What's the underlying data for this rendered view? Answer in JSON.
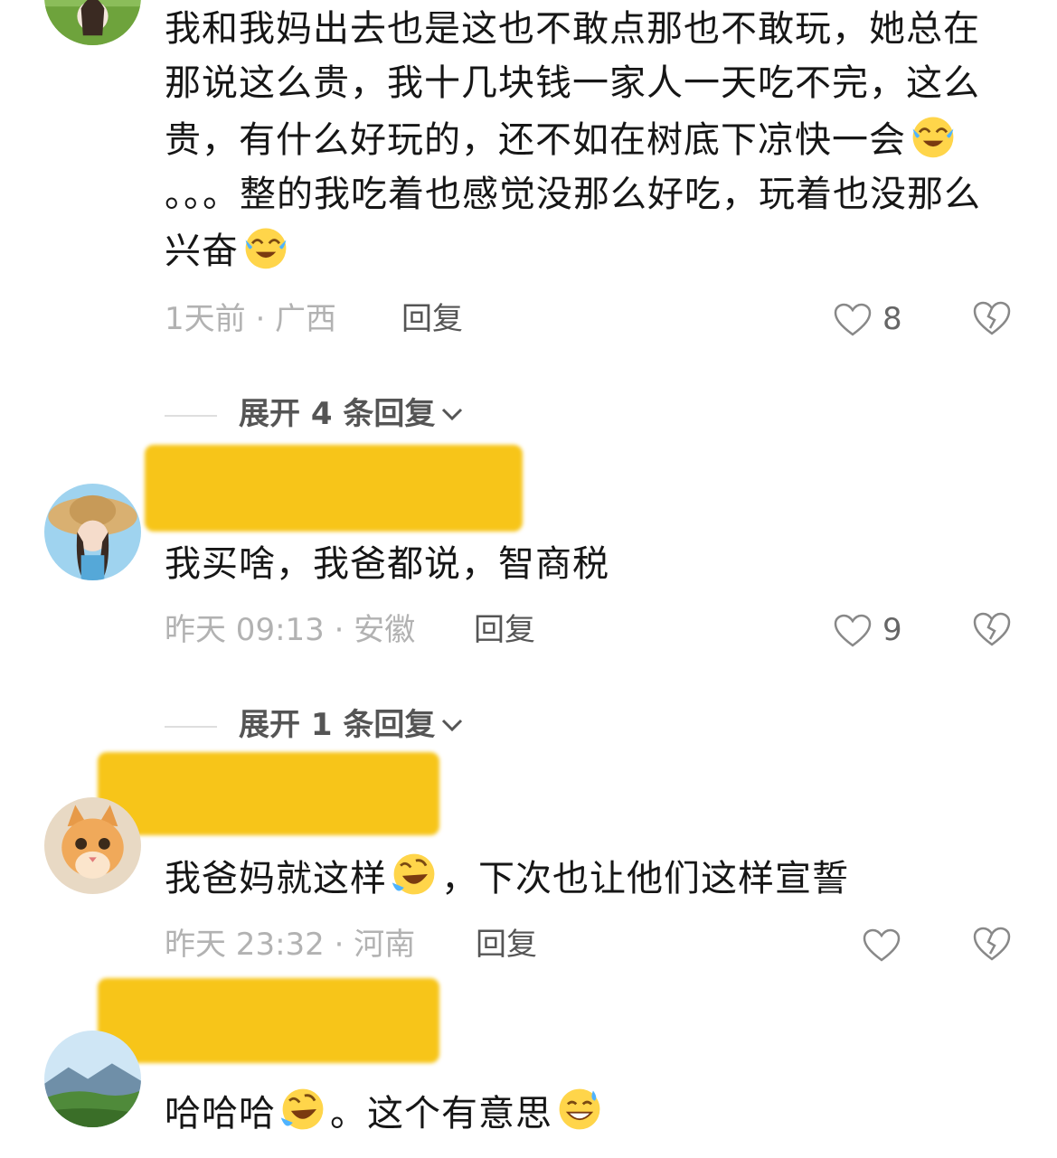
{
  "comments": [
    {
      "avatar": "avatar-girl-field",
      "text_parts": [
        "我和我妈出去也是这也不敢点那也不敢玩，她总在那说这么贵，我十几块钱一家人一天吃不完，这么贵，有什么好玩的，还不如在树底下凉快一会",
        {
          "emoji": "tears-of-joy-emoji"
        },
        "。。。整的我吃着也感觉没那么好吃，玩着也没那么兴奋",
        {
          "emoji": "tears-of-joy-emoji"
        }
      ],
      "time_location": "1天前 · 广西",
      "reply_label": "回复",
      "likes": "8"
    },
    {
      "avatar": "avatar-girl-straw-hat",
      "text_parts": [
        "我买啥，我爸都说，智商税"
      ],
      "time_location": "昨天 09:13 · 安徽",
      "reply_label": "回复",
      "likes": "9"
    },
    {
      "avatar": "avatar-orange-kitten",
      "text_parts": [
        "我爸妈就这样",
        {
          "emoji": "rolling-laughing-emoji"
        },
        "，下次也让他们这样宣誓"
      ],
      "time_location": "昨天 23:32 · 河南",
      "reply_label": "回复",
      "likes": ""
    },
    {
      "avatar": "avatar-mountain-landscape",
      "text_parts": [
        "哈哈哈",
        {
          "emoji": "rolling-laughing-emoji"
        },
        "。这个有意思",
        {
          "emoji": "grinning-sweat-emoji"
        }
      ]
    }
  ],
  "expand_1": "展开 4 条回复",
  "expand_2": "展开 1 条回复",
  "colors": {
    "redaction": "#f7c519",
    "meta_text": "#b2b2b2",
    "reply_text": "#555555"
  }
}
